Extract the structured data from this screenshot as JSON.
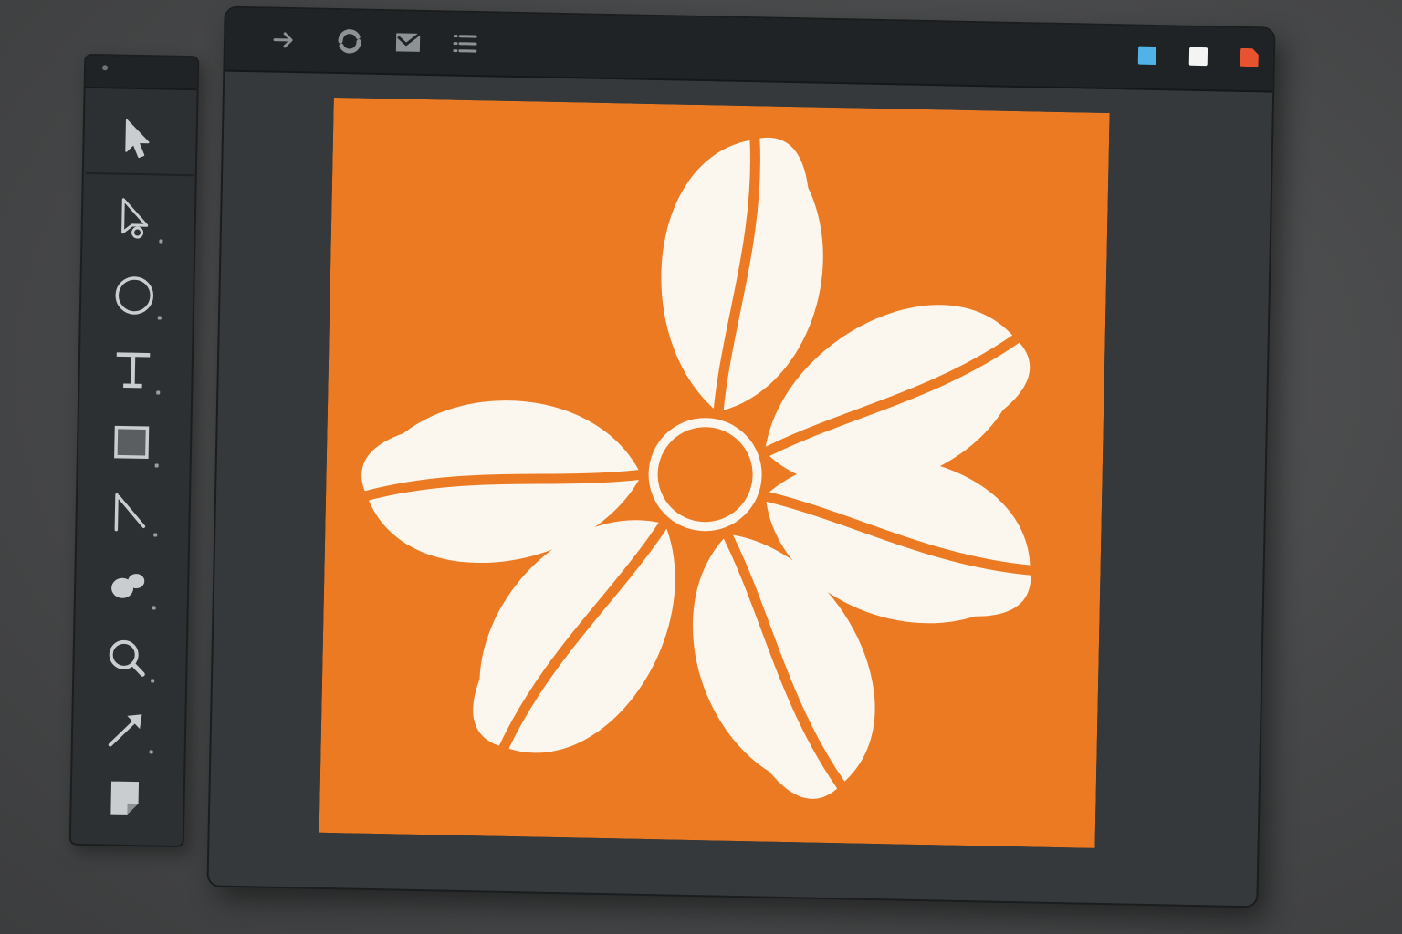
{
  "theme": {
    "workspace_bg": "#474849",
    "panel_bg": "#2c3032",
    "titlebar_bg": "#1f2325",
    "canvas_bg": "#35393b",
    "icon_color": "#c9cdcf",
    "artwork_fill": "#ec7a22",
    "artwork_petals": "#fcf7ee"
  },
  "toolbox": {
    "tools": [
      {
        "name": "selection-tool",
        "icon": "arrow-cursor-icon"
      },
      {
        "name": "direct-selection-tool",
        "icon": "pen-cursor-icon"
      },
      {
        "name": "ellipse-tool",
        "icon": "circle-icon"
      },
      {
        "name": "type-tool",
        "icon": "text-t-icon"
      },
      {
        "name": "rectangle-tool",
        "icon": "square-icon"
      },
      {
        "name": "line-tool",
        "icon": "line-icon"
      },
      {
        "name": "shape-builder-tool",
        "icon": "blob-icon"
      },
      {
        "name": "zoom-tool",
        "icon": "magnifier-icon"
      },
      {
        "name": "arrow-tool",
        "icon": "diagonal-arrow-icon"
      },
      {
        "name": "note-tool",
        "icon": "note-icon"
      }
    ]
  },
  "titlebar": {
    "buttons": [
      {
        "name": "forward-button",
        "icon": "arrow-right-icon"
      },
      {
        "name": "sync-button",
        "icon": "refresh-icon"
      },
      {
        "name": "mail-button",
        "icon": "envelope-icon"
      },
      {
        "name": "menu-button",
        "icon": "hamburger-icon"
      }
    ],
    "swatches": [
      {
        "name": "swatch-blue",
        "color": "#4fb3e8"
      },
      {
        "name": "swatch-white",
        "color": "#f4f4f2"
      },
      {
        "name": "swatch-red",
        "color": "#e8532f"
      }
    ]
  },
  "document": {
    "artwork": "six-petal-flower",
    "petal_count": 6
  }
}
